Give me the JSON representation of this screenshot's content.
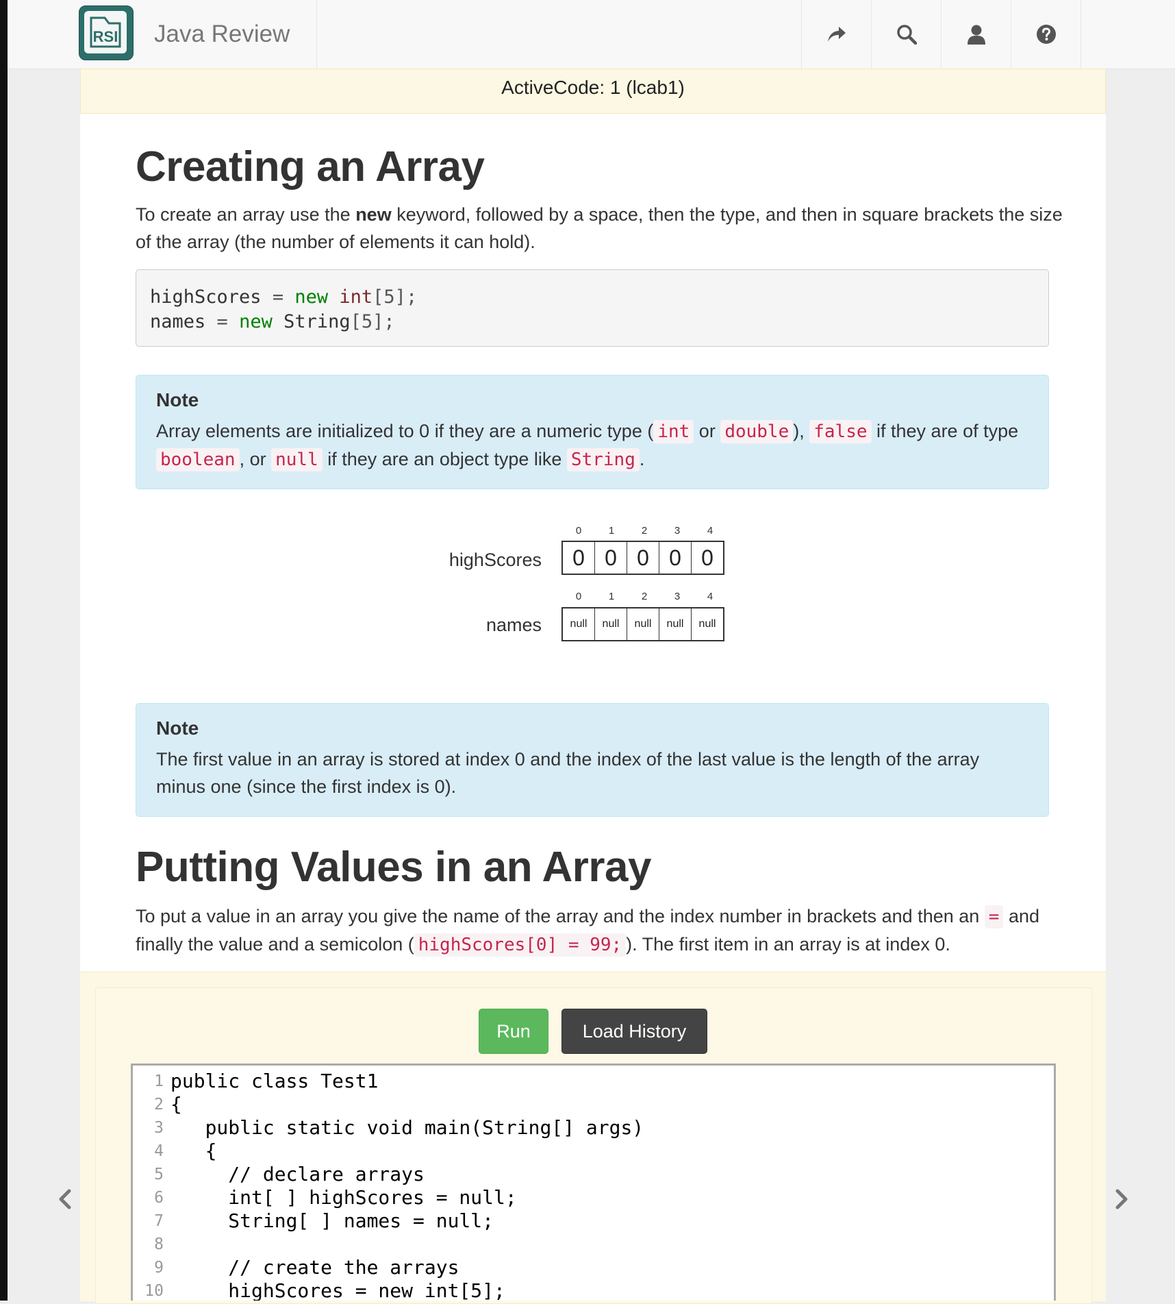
{
  "navbar": {
    "logo_text": "RSI",
    "brand": "Java Review",
    "icons": [
      "share-icon",
      "search-icon",
      "user-icon",
      "help-icon"
    ]
  },
  "activecode_header": "ActiveCode: 1 (lcab1)",
  "section1": {
    "title": "Creating an Array",
    "intro_before": "To create an array use the ",
    "intro_bold": "new",
    "intro_after": " keyword, followed by a space, then the type, and then in square brackets the size of the array (the number of elements it can hold).",
    "code": {
      "line1": {
        "var": "highScores",
        "eq": " = ",
        "kw": "new",
        "type": "int",
        "rest": "[5];"
      },
      "line2": {
        "var": "names",
        "eq": " = ",
        "kw": "new",
        "type": "String",
        "rest": "[5];"
      }
    }
  },
  "note1": {
    "title": "Note",
    "t1": "Array elements are initialized to 0 if they are a numeric type (",
    "c1": "int",
    "t2": " or ",
    "c2": "double",
    "t3": "), ",
    "c3": "false",
    "t4": " if they are of type ",
    "c4": "boolean",
    "t5": ", or ",
    "c5": "null",
    "t6": " if they are an object type like ",
    "c6": "String",
    "t7": "."
  },
  "diagram": {
    "highScores": {
      "label": "highScores",
      "indices": [
        "0",
        "1",
        "2",
        "3",
        "4"
      ],
      "values": [
        "0",
        "0",
        "0",
        "0",
        "0"
      ]
    },
    "names": {
      "label": "names",
      "indices": [
        "0",
        "1",
        "2",
        "3",
        "4"
      ],
      "values": [
        "null",
        "null",
        "null",
        "null",
        "null"
      ]
    }
  },
  "note2": {
    "title": "Note",
    "body": "The first value in an array is stored at index 0 and the index of the last value is the length of the array minus one (since the first index is 0)."
  },
  "section2": {
    "title": "Putting Values in an Array",
    "t1": "To put a value in an array you give the name of the array and the index number in brackets and then an ",
    "c1": "=",
    "t2": " and finally the value and a semicolon (",
    "c2": "highScores[0] = 99;",
    "t3": "). The first item in an array is at index 0."
  },
  "activecode": {
    "run_label": "Run",
    "history_label": "Load History",
    "lines": [
      {
        "n": "1",
        "text": "public class Test1"
      },
      {
        "n": "2",
        "text": "{"
      },
      {
        "n": "3",
        "text": "   public static void main(String[] args)"
      },
      {
        "n": "4",
        "text": "   {"
      },
      {
        "n": "5",
        "text": "     // declare arrays"
      },
      {
        "n": "6",
        "text": "     int[ ] highScores = null;"
      },
      {
        "n": "7",
        "text": "     String[ ] names = null;"
      },
      {
        "n": "8",
        "text": ""
      },
      {
        "n": "9",
        "text": "     // create the arrays"
      },
      {
        "n": "10",
        "text": "     highScores = new int[5];"
      }
    ]
  },
  "colors": {
    "run": "#5cb85c",
    "history": "#444444",
    "note_bg": "#d9edf7",
    "activecode_bg": "#fcf8e3",
    "inline_code": "#c7254e"
  }
}
